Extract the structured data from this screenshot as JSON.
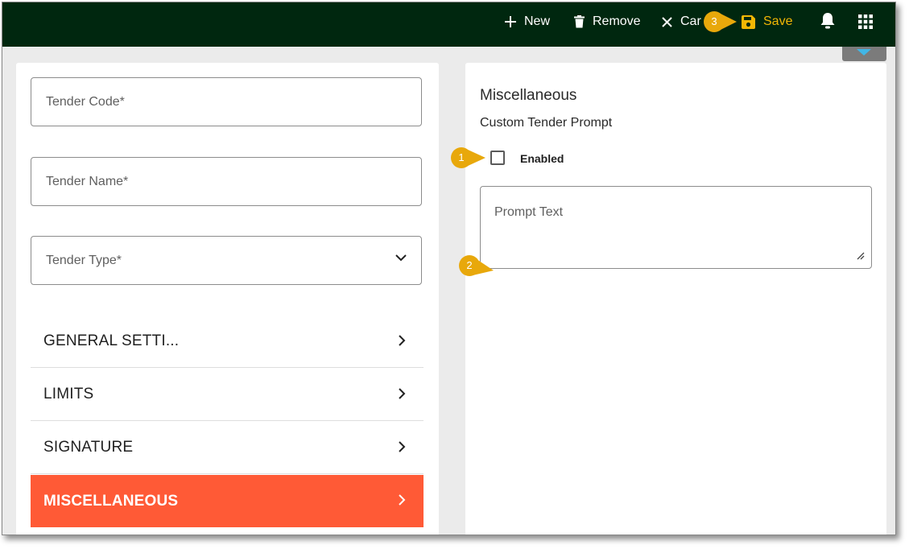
{
  "toolbar": {
    "new_label": "New",
    "remove_label": "Remove",
    "cancel_label": "Car",
    "save_label": "Save"
  },
  "form": {
    "tender_code_placeholder": "Tender Code*",
    "tender_name_placeholder": "Tender Name*",
    "tender_type_placeholder": "Tender Type*"
  },
  "nav": {
    "items": [
      {
        "label": "GENERAL SETTI..."
      },
      {
        "label": "LIMITS"
      },
      {
        "label": "SIGNATURE"
      },
      {
        "label": "MISCELLANEOUS",
        "active": true
      }
    ]
  },
  "misc": {
    "title": "Miscellaneous",
    "subtitle": "Custom Tender Prompt",
    "enabled_label": "Enabled",
    "enabled_checked": false,
    "prompt_placeholder": "Prompt Text"
  },
  "callouts": [
    "1",
    "2",
    "3"
  ],
  "colors": {
    "topbar": "#00270f",
    "accent_save": "#f2b705",
    "active_nav": "#ff5a36",
    "callout": "#e8a80b",
    "panel_bg": "#ebebeb"
  },
  "icons": [
    "plus-icon",
    "trash-icon",
    "close-icon",
    "save-icon",
    "bell-icon",
    "apps-grid-icon",
    "chevron-down-icon",
    "chevron-right-icon",
    "resize-grip-icon"
  ]
}
